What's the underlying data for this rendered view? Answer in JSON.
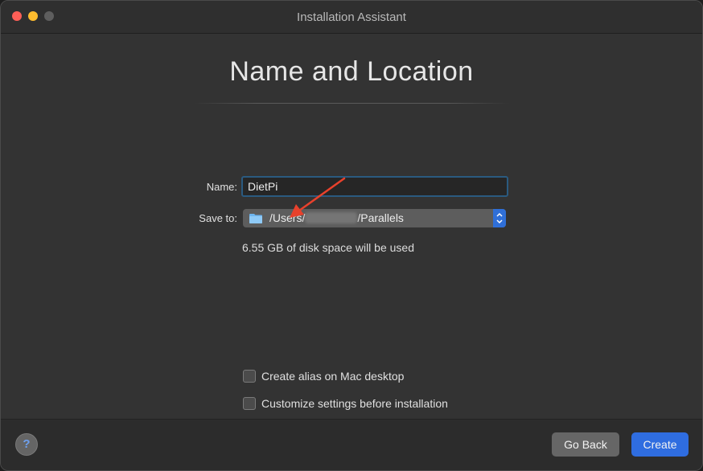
{
  "window": {
    "title": "Installation Assistant"
  },
  "page": {
    "heading": "Name and Location"
  },
  "form": {
    "name_label": "Name:",
    "name_value": "DietPi",
    "save_label": "Save to:",
    "save_path_prefix": "/Users/",
    "save_path_suffix": "/Parallels",
    "disk_info": "6.55 GB of disk space will be used"
  },
  "options": [
    {
      "label": "Create alias on Mac desktop",
      "checked": false
    },
    {
      "label": "Customize settings before installation",
      "checked": false
    }
  ],
  "footer": {
    "help_label": "?",
    "back_label": "Go Back",
    "create_label": "Create"
  },
  "colors": {
    "accent": "#2f6de0",
    "annotation_arrow": "#e8412c"
  },
  "icons": {
    "save_location": "folder-icon",
    "stepper": "up-down-chevron-icon"
  }
}
